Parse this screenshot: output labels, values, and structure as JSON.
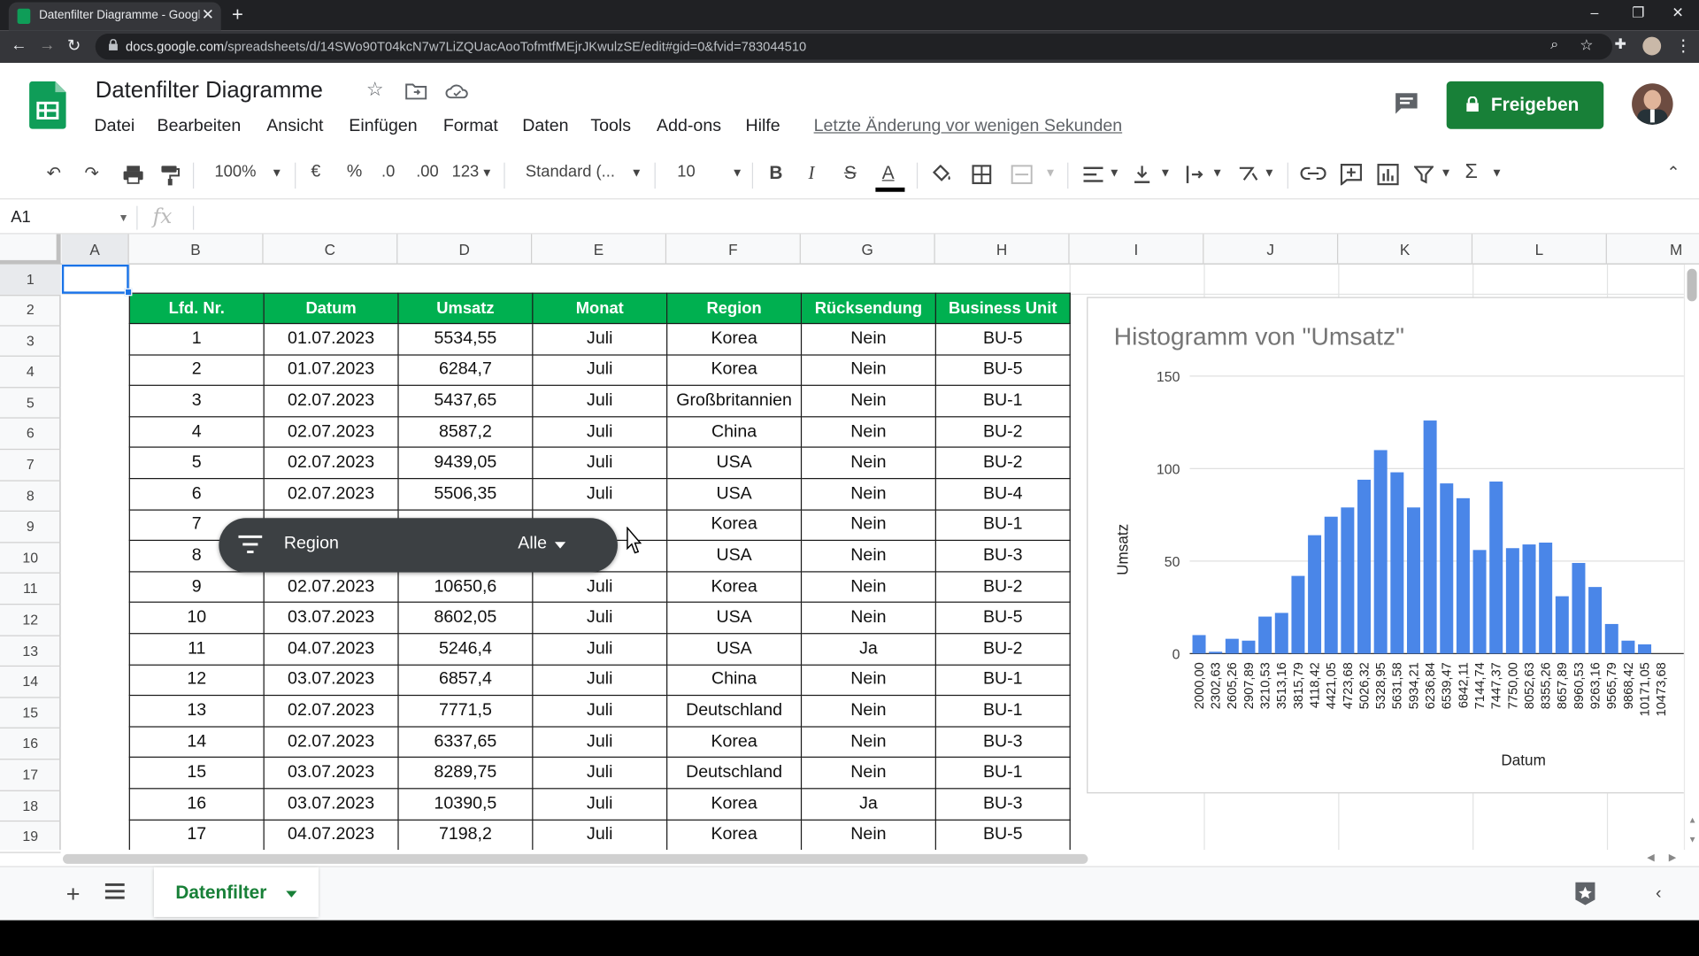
{
  "browser": {
    "tab_title": "Datenfilter Diagramme - Google",
    "url_domain": "docs.google.com",
    "url_path": "/spreadsheets/d/14SWo90T04kcN7w7LiZQUacAooTofmtfMEjrJKwulzSE/edit#gid=0&fvid=783044510"
  },
  "app": {
    "doc_title": "Datenfilter Diagramme",
    "menus": [
      "Datei",
      "Bearbeiten",
      "Ansicht",
      "Einfügen",
      "Format",
      "Daten",
      "Tools",
      "Add-ons",
      "Hilfe"
    ],
    "last_edit": "Letzte Änderung vor wenigen Sekunden",
    "share_label": "Freigeben"
  },
  "toolbar": {
    "zoom": "100%",
    "currency": "€",
    "percent": "%",
    "dec_less": ".0",
    "dec_more": ".00",
    "more_formats": "123",
    "font": "Standard (...",
    "font_size": "10"
  },
  "formula_bar": {
    "namebox": "A1",
    "fx": "fx"
  },
  "columns": [
    "A",
    "B",
    "C",
    "D",
    "E",
    "F",
    "G",
    "H",
    "I",
    "J",
    "K",
    "L",
    "M"
  ],
  "rows": [
    "1",
    "2",
    "3",
    "4",
    "5",
    "6",
    "7",
    "8",
    "9",
    "10",
    "11",
    "12",
    "13",
    "14",
    "15",
    "16",
    "17",
    "18",
    "19"
  ],
  "table": {
    "headers": [
      "Lfd. Nr.",
      "Datum",
      "Umsatz",
      "Monat",
      "Region",
      "Rücksendung",
      "Business Unit"
    ],
    "rows": [
      [
        "1",
        "01.07.2023",
        "5534,55",
        "Juli",
        "Korea",
        "Nein",
        "BU-5"
      ],
      [
        "2",
        "01.07.2023",
        "6284,7",
        "Juli",
        "Korea",
        "Nein",
        "BU-5"
      ],
      [
        "3",
        "02.07.2023",
        "5437,65",
        "Juli",
        "Großbritannien",
        "Nein",
        "BU-1"
      ],
      [
        "4",
        "02.07.2023",
        "8587,2",
        "Juli",
        "China",
        "Nein",
        "BU-2"
      ],
      [
        "5",
        "02.07.2023",
        "9439,05",
        "Juli",
        "USA",
        "Nein",
        "BU-2"
      ],
      [
        "6",
        "02.07.2023",
        "5506,35",
        "Juli",
        "USA",
        "Nein",
        "BU-4"
      ],
      [
        "7",
        "",
        "",
        "",
        "Korea",
        "Nein",
        "BU-1"
      ],
      [
        "8",
        "",
        "",
        "",
        "USA",
        "Nein",
        "BU-3"
      ],
      [
        "9",
        "02.07.2023",
        "10650,6",
        "Juli",
        "Korea",
        "Nein",
        "BU-2"
      ],
      [
        "10",
        "03.07.2023",
        "8602,05",
        "Juli",
        "USA",
        "Nein",
        "BU-5"
      ],
      [
        "11",
        "04.07.2023",
        "5246,4",
        "Juli",
        "USA",
        "Ja",
        "BU-2"
      ],
      [
        "12",
        "03.07.2023",
        "6857,4",
        "Juli",
        "China",
        "Nein",
        "BU-1"
      ],
      [
        "13",
        "02.07.2023",
        "7771,5",
        "Juli",
        "Deutschland",
        "Nein",
        "BU-1"
      ],
      [
        "14",
        "02.07.2023",
        "6337,65",
        "Juli",
        "Korea",
        "Nein",
        "BU-3"
      ],
      [
        "15",
        "03.07.2023",
        "8289,75",
        "Juli",
        "Deutschland",
        "Nein",
        "BU-1"
      ],
      [
        "16",
        "03.07.2023",
        "10390,5",
        "Juli",
        "Korea",
        "Ja",
        "BU-3"
      ],
      [
        "17",
        "04.07.2023",
        "7198,2",
        "Juli",
        "Korea",
        "Nein",
        "BU-5"
      ]
    ]
  },
  "filter_chip": {
    "label": "Region",
    "value": "Alle"
  },
  "sheet_tab": {
    "label": "Datenfilter"
  },
  "colors": {
    "header_green": "#00b050",
    "bar_blue": "#4a86e8",
    "share_green": "#188038"
  },
  "chart_data": {
    "type": "bar",
    "title": "Histogramm von \"Umsatz\"",
    "xlabel": "Datum",
    "ylabel": "Umsatz",
    "ylim": [
      0,
      150
    ],
    "yticks": [
      "0",
      "50",
      "100",
      "150"
    ],
    "categories": [
      "2000,00",
      "2302,63",
      "2605,26",
      "2907,89",
      "3210,53",
      "3513,16",
      "3815,79",
      "4118,42",
      "4421,05",
      "4723,68",
      "5026,32",
      "5328,95",
      "5631,58",
      "5934,21",
      "6236,84",
      "6539,47",
      "6842,11",
      "7144,74",
      "7447,37",
      "7750,00",
      "8052,63",
      "8355,26",
      "8657,89",
      "8960,53",
      "9263,16",
      "9565,79",
      "9868,42",
      "10171,05",
      "10473,68"
    ],
    "values": [
      10,
      1,
      8,
      7,
      20,
      22,
      42,
      64,
      74,
      79,
      94,
      110,
      98,
      79,
      126,
      92,
      84,
      56,
      93,
      57,
      59,
      60,
      31,
      49,
      36,
      16,
      7,
      5,
      0
    ]
  }
}
